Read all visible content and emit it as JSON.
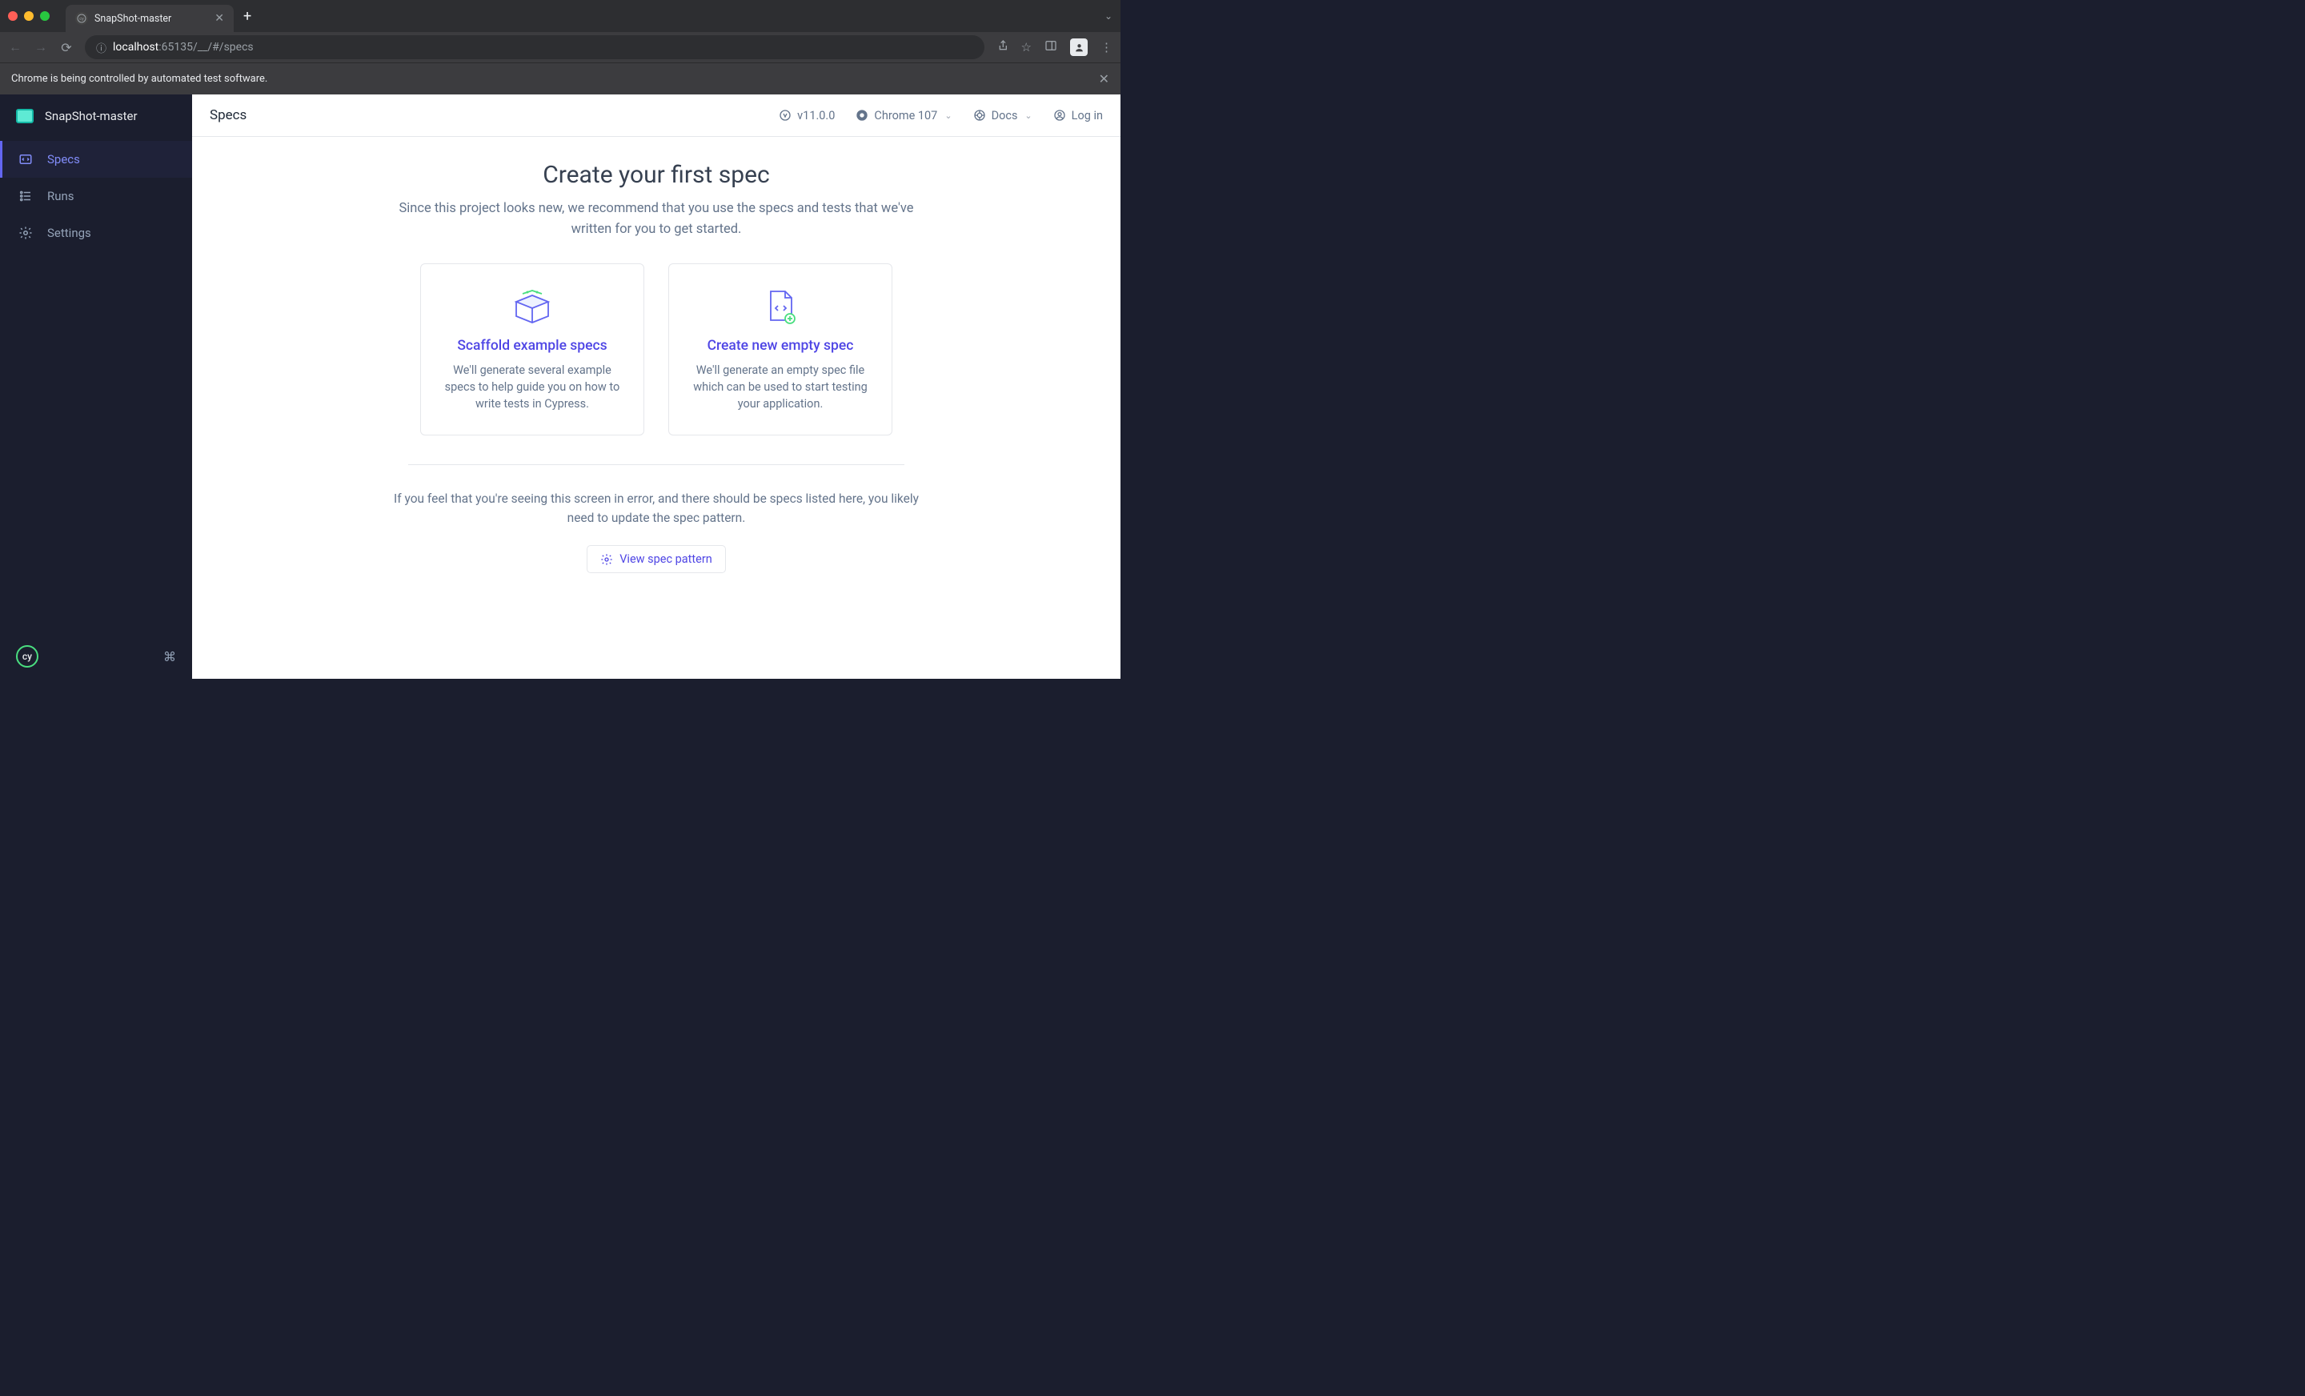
{
  "browser": {
    "tab_title": "SnapShot-master",
    "url_host": "localhost",
    "url_port": ":65135",
    "url_path": "/__/#/specs",
    "automation_banner": "Chrome is being controlled by automated test software."
  },
  "sidebar": {
    "project_name": "SnapShot-master",
    "items": [
      {
        "label": "Specs"
      },
      {
        "label": "Runs"
      },
      {
        "label": "Settings"
      }
    ]
  },
  "header": {
    "title": "Specs",
    "version": "v11.0.0",
    "browser": "Chrome 107",
    "docs": "Docs",
    "login": "Log in"
  },
  "main": {
    "heading": "Create your first spec",
    "subheading": "Since this project looks new, we recommend that you use the specs and tests that we've written for you to get started.",
    "cards": [
      {
        "title": "Scaffold example specs",
        "desc": "We'll generate several example specs to help guide you on how to write tests in Cypress."
      },
      {
        "title": "Create new empty spec",
        "desc": "We'll generate an empty spec file which can be used to start testing your application."
      }
    ],
    "error_text": "If you feel that you're seeing this screen in error, and there should be specs listed here, you likely need to update the spec pattern.",
    "pattern_button": "View spec pattern"
  }
}
